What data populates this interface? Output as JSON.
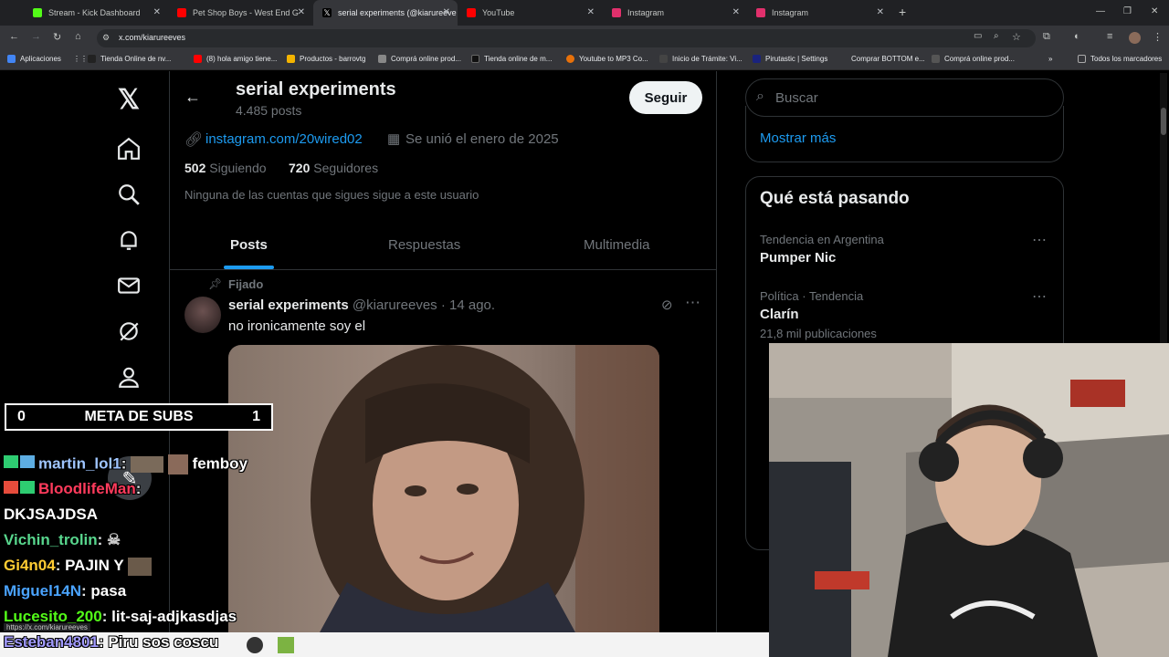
{
  "browser": {
    "tabs": [
      {
        "label": "Stream - Kick Dashboard",
        "color": "#53fc18"
      },
      {
        "label": "Pet Shop Boys - West End G",
        "color": "#ff0000"
      },
      {
        "label": "serial experiments (@kiarureeve",
        "color": "#ffffff"
      },
      {
        "label": "YouTube",
        "color": "#ff0000"
      },
      {
        "label": "Instagram",
        "color": "#e1306c"
      },
      {
        "label": "Instagram",
        "color": "#e1306c"
      }
    ],
    "url": "x.com/kiarureeves",
    "status_url": "https://x.com/kiarureeves",
    "bookmarks": [
      "Aplicaciones",
      "Tienda Online de nv...",
      "(8) hola amigo tiene...",
      "Productos - barrovtg",
      "Comprá online prod...",
      "Tienda online de m...",
      "Youtube to MP3 Co...",
      "Inicio de Trámite: Vi...",
      "Pirutastic | Settings",
      "Comprar BOTTOM e...",
      "Comprá online prod...",
      "Todos los marcadores"
    ]
  },
  "profile": {
    "name": "serial experiments",
    "post_count": "4.485 posts",
    "follow_label": "Seguir",
    "link": "instagram.com/20wired02",
    "joined": "Se unió el enero de 2025",
    "following_count": "502",
    "following_label": "Siguiendo",
    "followers_count": "720",
    "followers_label": "Seguidores",
    "mutuals_note": "Ninguna de las cuentas que sigues sigue a este usuario",
    "tabs": [
      "Posts",
      "Respuestas",
      "Multimedia"
    ]
  },
  "post": {
    "pinned_label": "Fijado",
    "author": "serial experiments",
    "handle": "@kiarureeves",
    "date": "· 14 ago.",
    "text": "no ironicamente soy el"
  },
  "sidebar": {
    "search_placeholder": "Buscar",
    "show_more": "Mostrar más",
    "trends_title": "Qué está pasando",
    "trends": [
      {
        "context": "Tendencia en Argentina",
        "topic": "Pumper Nic",
        "count": ""
      },
      {
        "context": "Política · Tendencia",
        "topic": "Clarín",
        "count": "21,8 mil publicaciones"
      }
    ]
  },
  "stream": {
    "goal_left": "0",
    "goal_label": "META DE SUBS",
    "goal_right": "1",
    "chat": [
      {
        "user": "martin_lol1",
        "msg": "femboy",
        "color": "#9fc5ff"
      },
      {
        "user": "BloodlifeMan",
        "msg": "",
        "color": "#ff3b5c"
      },
      {
        "user": "",
        "msg": "DKJSAJDSA",
        "color": "#ffffff"
      },
      {
        "user": "Vichin_trolin",
        "msg": "",
        "color": "#58d68d"
      },
      {
        "user": "Gi4n04",
        "msg": "PAJIN Y",
        "color": "#ffcc33"
      },
      {
        "user": "Miguel14N",
        "msg": "pasa",
        "color": "#4aa3ff"
      },
      {
        "user": "Lucesito_200",
        "msg": "lit-saj-adjkasdjas",
        "color": "#53fc18"
      },
      {
        "user": "Esteban4801",
        "msg": "Piru sos coscu",
        "color": "#a29bfe"
      }
    ]
  }
}
